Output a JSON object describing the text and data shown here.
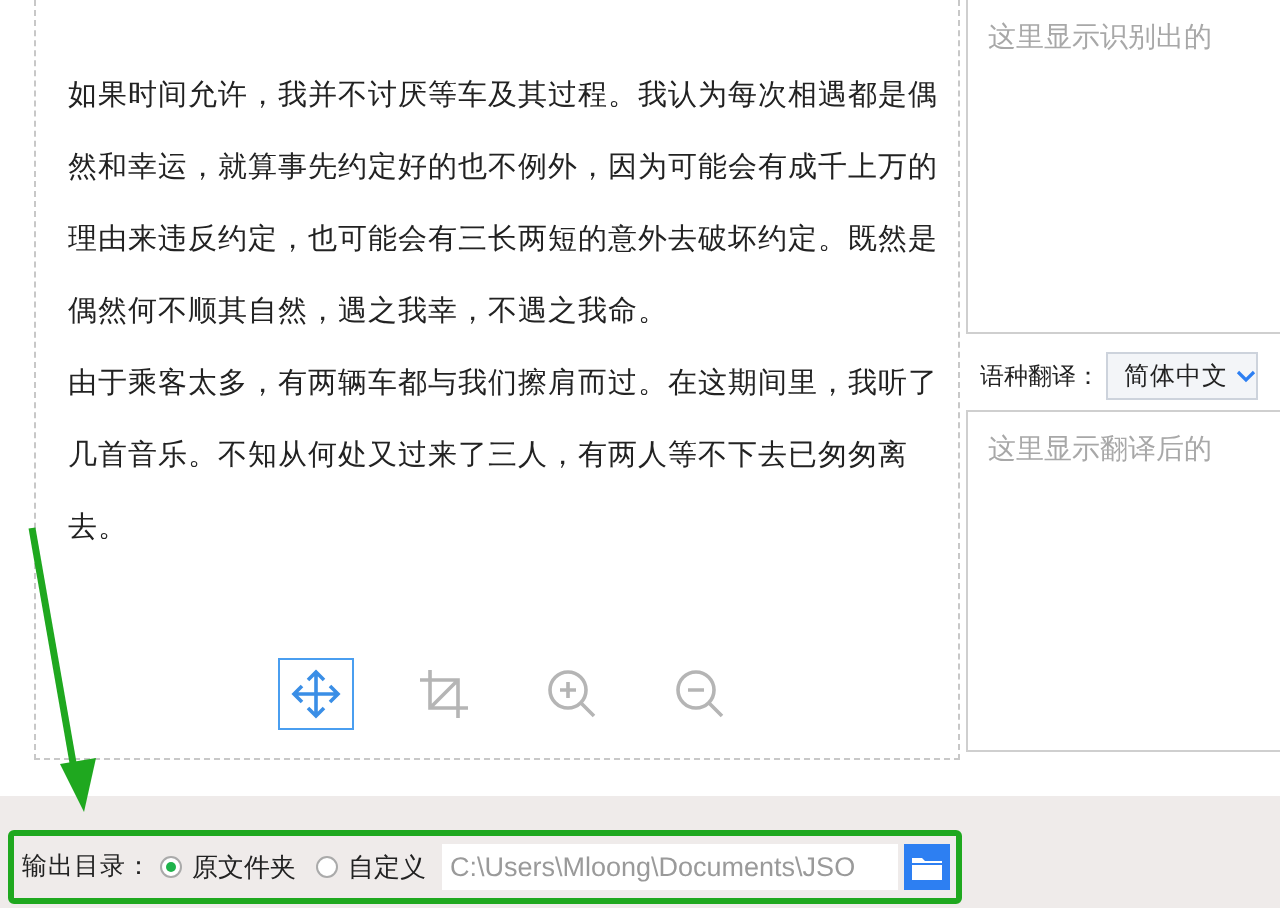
{
  "document": {
    "paragraphs": [
      "如果时间允许，我并不讨厌等车及其过程。我认为每次相遇都是偶然和幸运，就算事先约定好的也不例外，因为可能会有成千上万的理由来违反约定，也可能会有三长两短的意外去破坏约定。既然是偶然何不顺其自然，遇之我幸，不遇之我命。",
      "由于乘客太多，有两辆车都与我们擦肩而过。在这期间里，我听了几首音乐。不知从何处又过来了三人，有两人等不下去已匆匆离去。"
    ]
  },
  "tools": [
    {
      "kind": "move",
      "selected": true
    },
    {
      "kind": "crop",
      "selected": false
    },
    {
      "kind": "zoom-in",
      "selected": false
    },
    {
      "kind": "zoom-out",
      "selected": false
    }
  ],
  "recognized_text": {
    "placeholder": "这里显示识别出的"
  },
  "translation": {
    "label": "语种翻译：",
    "language": "简体中文",
    "placeholder": "这里显示翻译后的"
  },
  "output": {
    "label": "输出目录：",
    "options": [
      {
        "label": "原文件夹",
        "selected": true
      },
      {
        "label": "自定义",
        "selected": false
      }
    ],
    "path": "C:\\Users\\Mloong\\Documents\\JSO"
  }
}
